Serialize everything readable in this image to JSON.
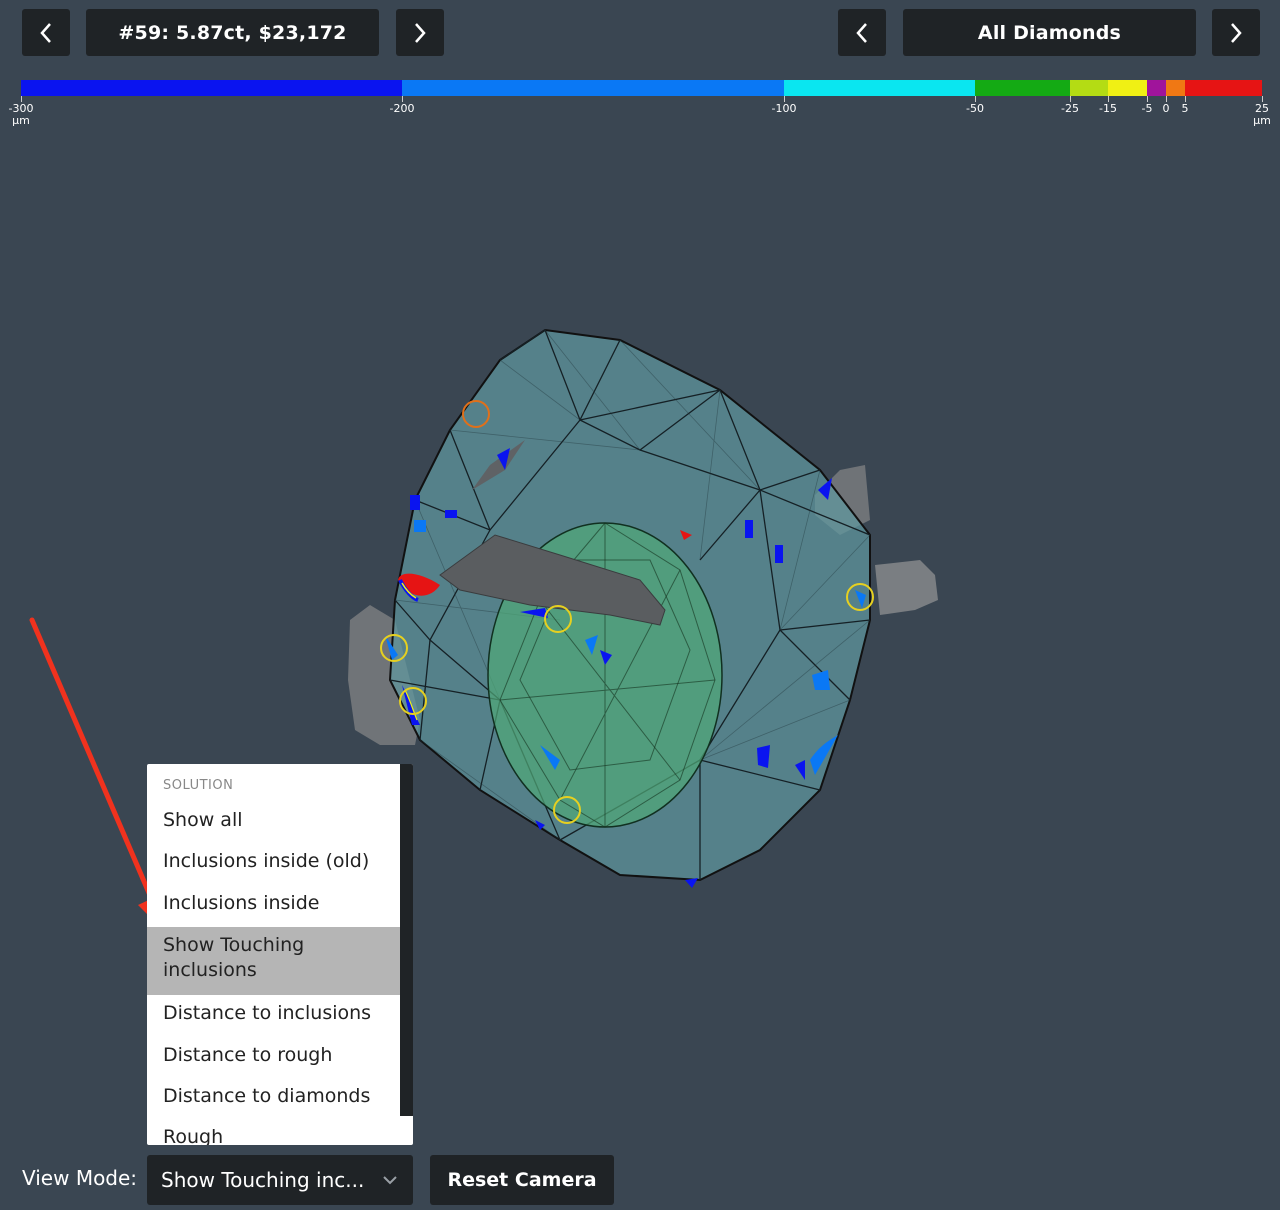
{
  "header": {
    "diamond_label": "#59: 5.87ct, $23,172",
    "set_label": "All Diamonds",
    "prev_icon": "chevron-left-icon",
    "next_icon": "chevron-right-icon"
  },
  "colorbar": {
    "segments": [
      {
        "color": "#0a14f0",
        "from": -300,
        "to": -200
      },
      {
        "color": "#0a78f5",
        "from": -200,
        "to": -100
      },
      {
        "color": "#0ae6f0",
        "from": -100,
        "to": -50
      },
      {
        "color": "#14aa14",
        "from": -50,
        "to": -25
      },
      {
        "color": "#b4dc14",
        "from": -25,
        "to": -15
      },
      {
        "color": "#f0f014",
        "from": -15,
        "to": -5
      },
      {
        "color": "#a0149b",
        "from": -5,
        "to": 0
      },
      {
        "color": "#f07814",
        "from": 0,
        "to": 5
      },
      {
        "color": "#e61414",
        "from": 5,
        "to": 25
      }
    ],
    "tick_labels": [
      "-300",
      "-200",
      "-100",
      "-50",
      "-25",
      "-15",
      "-5",
      "0",
      "5",
      "25"
    ],
    "unit": "µm"
  },
  "dropdown": {
    "header": "SOLUTION",
    "items": [
      {
        "label": "Show all"
      },
      {
        "label": "Inclusions inside (old)"
      },
      {
        "label": "Inclusions inside"
      },
      {
        "label": "Show Touching inclusions"
      },
      {
        "label": "Distance to inclusions"
      },
      {
        "label": "Distance to rough"
      },
      {
        "label": "Distance to diamonds"
      },
      {
        "label": "Rough"
      }
    ],
    "selected": "Show Touching inclusions"
  },
  "footer": {
    "view_mode_label": "View Mode:",
    "view_mode_value": "Show Touching inc...",
    "reset_label": "Reset Camera",
    "chevron_icon": "chevron-down-icon"
  },
  "annotation": {
    "color": "#f0321e",
    "icon": "red-arrow-annotation"
  }
}
